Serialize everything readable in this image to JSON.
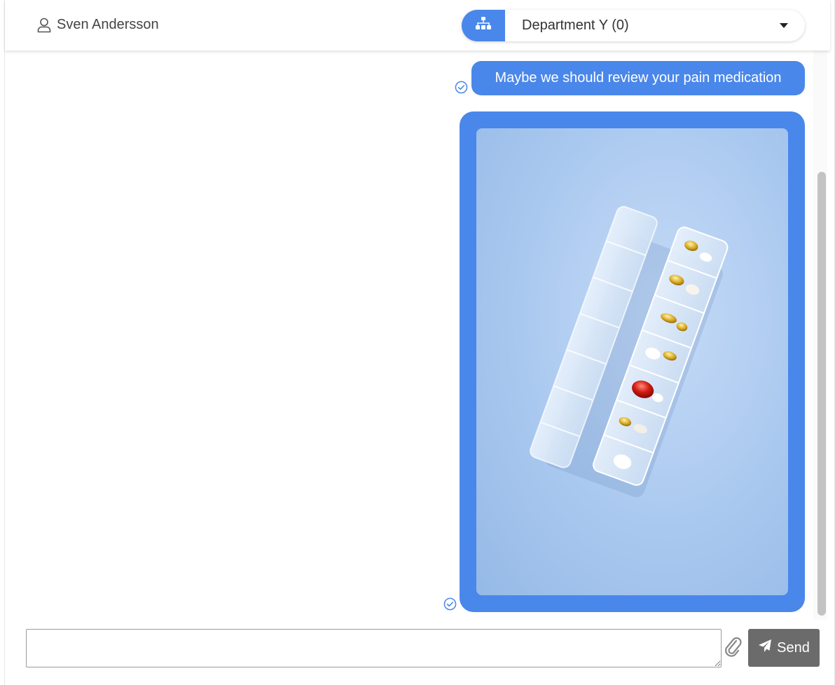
{
  "header": {
    "user_name": "Sven Andersson",
    "user_icon": "user-outline-icon",
    "department": {
      "label": "Department Y (0)",
      "icon": "org-chart-icon"
    }
  },
  "messages": [
    {
      "type": "text",
      "text": "Maybe we should review your pain medication",
      "status_icon": "check-circle-icon"
    },
    {
      "type": "image",
      "image_subject": "weekly pill organizer on blue background",
      "status_icon": "check-circle-icon"
    }
  ],
  "composer": {
    "input_value": "",
    "input_placeholder": "",
    "attach_icon": "paperclip-icon",
    "send_label": "Send",
    "send_icon": "paper-plane-icon"
  },
  "colors": {
    "accent": "#4a87ea",
    "send_button": "#6b6b6b",
    "scrollbar_thumb": "#c3c3c3"
  }
}
